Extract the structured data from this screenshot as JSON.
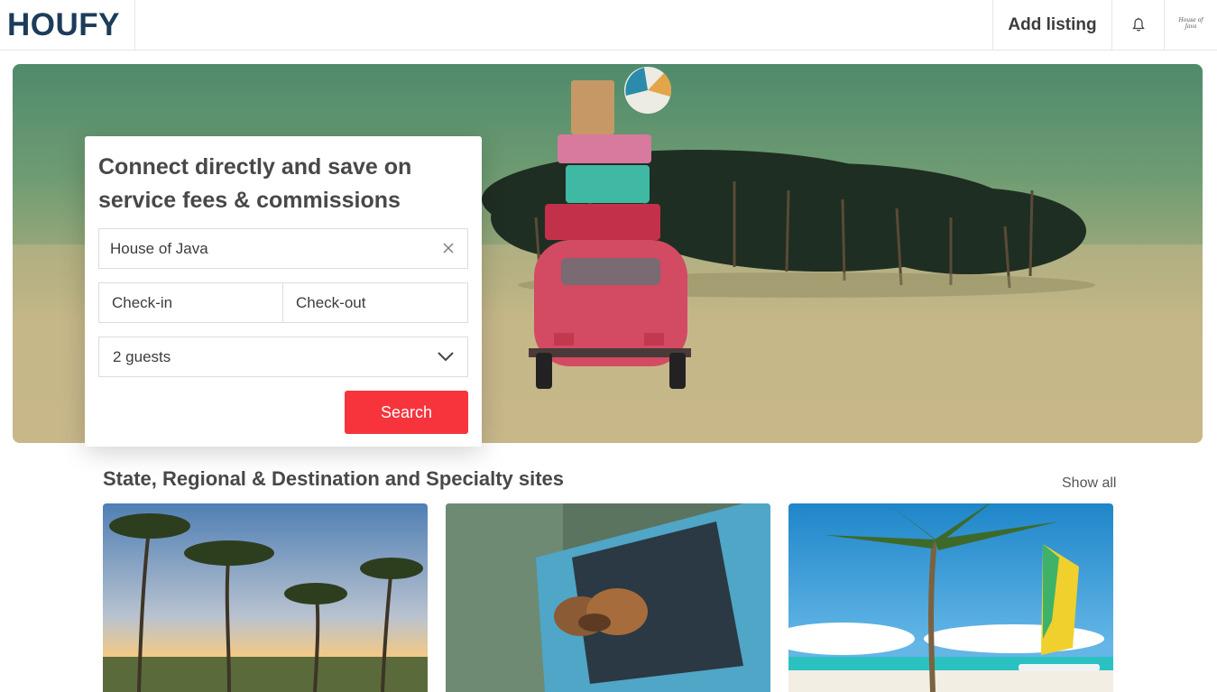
{
  "header": {
    "logo": "HOUFY",
    "add_listing": "Add listing",
    "avatar_text": "House of Java"
  },
  "hero": {
    "title": "Connect directly and save on service fees & commissions"
  },
  "search": {
    "location_value": "House of Java",
    "checkin_placeholder": "Check-in",
    "checkout_placeholder": "Check-out",
    "guests_value": "2 guests",
    "search_label": "Search"
  },
  "section": {
    "title": "State, Regional & Destination and Specialty sites",
    "show_all": "Show all"
  },
  "colors": {
    "brand": "#1c3c5a",
    "accent": "#f7343c"
  },
  "icons": {
    "bell": "bell-icon",
    "clear": "close-icon",
    "dropdown": "chevron-down-icon"
  }
}
